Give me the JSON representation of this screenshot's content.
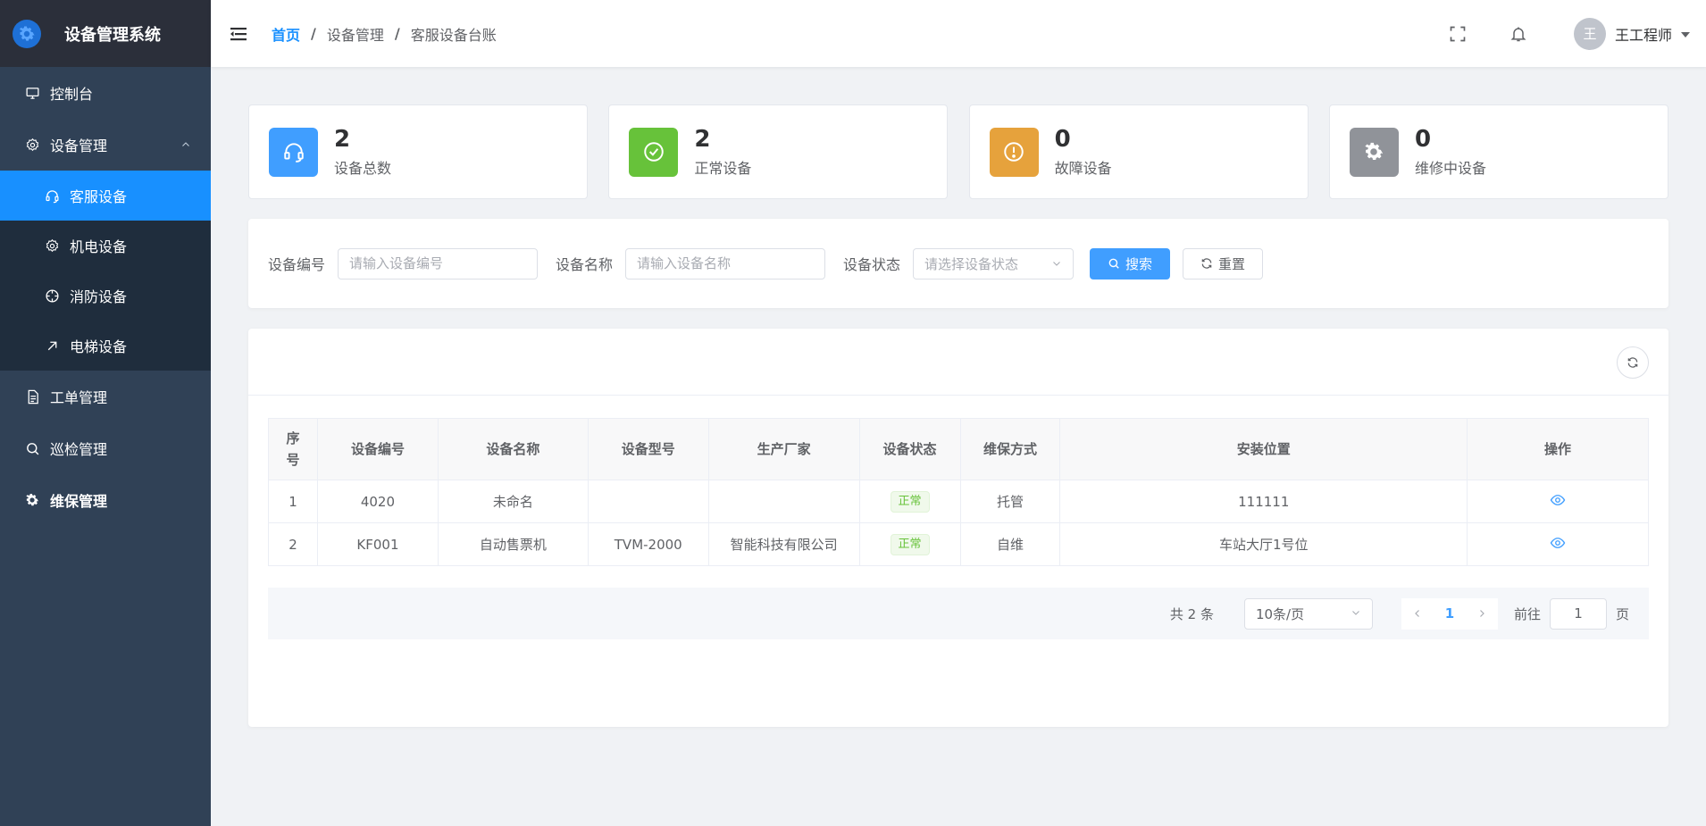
{
  "app": {
    "title": "设备管理系统"
  },
  "sidebar": {
    "items": [
      {
        "label": "控制台"
      },
      {
        "label": "设备管理"
      },
      {
        "label": "客服设备"
      },
      {
        "label": "机电设备"
      },
      {
        "label": "消防设备"
      },
      {
        "label": "电梯设备"
      },
      {
        "label": "工单管理"
      },
      {
        "label": "巡检管理"
      },
      {
        "label": "维保管理"
      }
    ]
  },
  "header": {
    "breadcrumb": [
      "首页",
      "设备管理",
      "客服设备台账"
    ],
    "breadcrumb_sep": "/",
    "avatar_text": "王",
    "username": "王工程师"
  },
  "stats": [
    {
      "value": "2",
      "label": "设备总数",
      "color": "#409eff",
      "icon": "headset-icon"
    },
    {
      "value": "2",
      "label": "正常设备",
      "color": "#67c23a",
      "icon": "check-circle-icon"
    },
    {
      "value": "0",
      "label": "故障设备",
      "color": "#e6a23c",
      "icon": "warning-icon"
    },
    {
      "value": "0",
      "label": "维修中设备",
      "color": "#909399",
      "icon": "gear-icon"
    }
  ],
  "search": {
    "code_label": "设备编号",
    "code_placeholder": "请输入设备编号",
    "name_label": "设备名称",
    "name_placeholder": "请输入设备名称",
    "status_label": "设备状态",
    "status_placeholder": "请选择设备状态",
    "search_btn": "搜索",
    "reset_btn": "重置"
  },
  "table": {
    "columns": [
      "序号",
      "设备编号",
      "设备名称",
      "设备型号",
      "生产厂家",
      "设备状态",
      "维保方式",
      "安装位置",
      "操作"
    ],
    "rows": [
      {
        "index": "1",
        "code": "4020",
        "name": "未命名",
        "model": "",
        "maker": "",
        "status": "正常",
        "maintenance": "托管",
        "location": "111111"
      },
      {
        "index": "2",
        "code": "KF001",
        "name": "自动售票机",
        "model": "TVM-2000",
        "maker": "智能科技有限公司",
        "status": "正常",
        "maintenance": "自维",
        "location": "车站大厅1号位"
      }
    ]
  },
  "pagination": {
    "total": "共 2 条",
    "page_size": "10条/页",
    "current": "1",
    "goto_prefix": "前往",
    "goto_value": "1",
    "goto_suffix": "页"
  },
  "colors": {
    "accent": "#1890ff",
    "sidebar_bg": "#304156",
    "status_ok": "#67c23a"
  }
}
